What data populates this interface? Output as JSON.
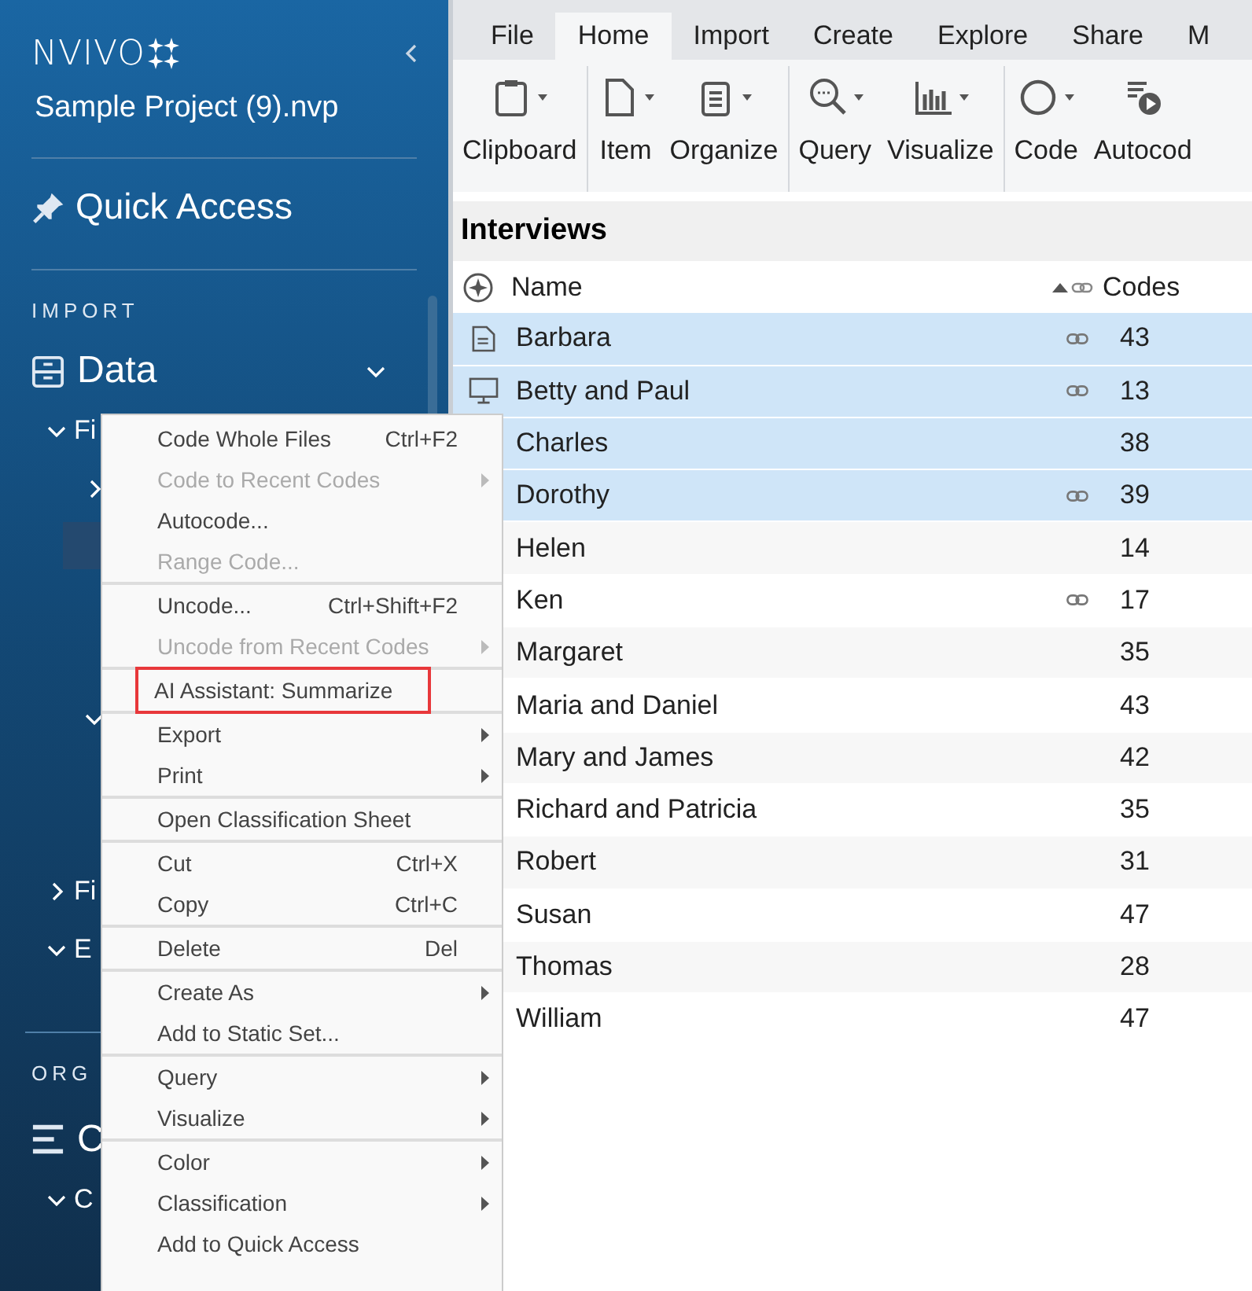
{
  "sidebar": {
    "logo": "NVIVO",
    "project": "Sample Project (9).nvp",
    "quick_access": "Quick Access",
    "section": "IMPORT",
    "data_heading": {
      "label": "Data",
      "expanded": true
    },
    "tree": [
      {
        "label": "Fi",
        "expanded": true,
        "children": [
          {
            "expanded": false
          },
          {
            "selected": true
          },
          {
            "expanded": true
          }
        ]
      },
      {
        "label": "Fi",
        "expanded": false
      },
      {
        "label": "E",
        "expanded": true
      }
    ],
    "section_2": "ORG",
    "heading_2": "C",
    "tree_2": [
      {
        "label": "C",
        "expanded": true
      }
    ]
  },
  "tabs": [
    {
      "label": "File",
      "selected": false
    },
    {
      "label": "Home",
      "selected": true
    },
    {
      "label": "Import",
      "selected": false
    },
    {
      "label": "Create",
      "selected": false
    },
    {
      "label": "Explore",
      "selected": false
    },
    {
      "label": "Share",
      "selected": false
    },
    {
      "label": "M",
      "selected": false
    }
  ],
  "ribbon": [
    [
      {
        "label": "Clipboard",
        "kind": "clipboard",
        "dropdown": true
      }
    ],
    [
      {
        "label": "Item",
        "kind": "file",
        "dropdown": true
      },
      {
        "label": "Organize",
        "kind": "list",
        "dropdown": true
      }
    ],
    [
      {
        "label": "Query",
        "kind": "search",
        "dropdown": true
      },
      {
        "label": "Visualize",
        "kind": "chart",
        "dropdown": true
      }
    ],
    [
      {
        "label": "Code",
        "kind": "circle",
        "dropdown": true
      },
      {
        "label": "Autocod",
        "kind": "autocode",
        "dropdown": false
      }
    ]
  ],
  "list": {
    "title": "Interviews",
    "columns": [
      "Name",
      "Codes"
    ],
    "rows": [
      {
        "name": "Barbara",
        "kind": "document",
        "linked": true,
        "codes": "43",
        "selected": true
      },
      {
        "name": "Betty and Paul",
        "kind": "video",
        "linked": true,
        "codes": "13",
        "selected": true
      },
      {
        "name": "Charles",
        "linked": false,
        "codes": "38",
        "selected": true
      },
      {
        "name": "Dorothy",
        "linked": true,
        "codes": "39",
        "selected": true
      },
      {
        "name": "Helen",
        "linked": false,
        "codes": "14",
        "selected": false
      },
      {
        "name": "Ken",
        "linked": true,
        "codes": "17",
        "selected": false
      },
      {
        "name": "Margaret",
        "linked": false,
        "codes": "35",
        "selected": false
      },
      {
        "name": "Maria and Daniel",
        "linked": false,
        "codes": "43",
        "selected": false
      },
      {
        "name": "Mary and James",
        "linked": false,
        "codes": "42",
        "selected": false
      },
      {
        "name": "Richard and Patricia",
        "linked": false,
        "codes": "35",
        "selected": false
      },
      {
        "name": "Robert",
        "linked": false,
        "codes": "31",
        "selected": false
      },
      {
        "name": "Susan",
        "linked": false,
        "codes": "47",
        "selected": false
      },
      {
        "name": "Thomas",
        "linked": false,
        "codes": "28",
        "selected": false
      },
      {
        "name": "William",
        "linked": false,
        "codes": "47",
        "selected": false
      }
    ]
  },
  "context_menu": [
    [
      {
        "label": "Code Whole Files",
        "shortcut": "Ctrl+F2",
        "disabled": false,
        "submenu": false
      },
      {
        "label": "Code to Recent Codes",
        "disabled": true,
        "submenu": true
      },
      {
        "label": "Autocode...",
        "disabled": false,
        "submenu": false
      },
      {
        "label": "Range Code...",
        "disabled": true,
        "submenu": false
      }
    ],
    [
      {
        "label": "Uncode...",
        "shortcut": "Ctrl+Shift+F2",
        "disabled": false,
        "submenu": false
      },
      {
        "label": "Uncode from Recent Codes",
        "disabled": true,
        "submenu": true
      }
    ],
    [
      {
        "label": "AI Assistant: Summarize",
        "disabled": false,
        "submenu": false,
        "highlighted": true
      }
    ],
    [
      {
        "label": "Export",
        "disabled": false,
        "submenu": true
      },
      {
        "label": "Print",
        "disabled": false,
        "submenu": true
      }
    ],
    [
      {
        "label": "Open Classification Sheet",
        "disabled": false,
        "submenu": false
      }
    ],
    [
      {
        "label": "Cut",
        "shortcut": "Ctrl+X",
        "disabled": false,
        "submenu": false
      },
      {
        "label": "Copy",
        "shortcut": "Ctrl+C",
        "disabled": false,
        "submenu": false
      }
    ],
    [
      {
        "label": "Delete",
        "shortcut": "Del",
        "disabled": false,
        "submenu": false
      }
    ],
    [
      {
        "label": "Create As",
        "disabled": false,
        "submenu": true
      },
      {
        "label": "Add to Static Set...",
        "disabled": false,
        "submenu": false
      }
    ],
    [
      {
        "label": "Query",
        "disabled": false,
        "submenu": true
      },
      {
        "label": "Visualize",
        "disabled": false,
        "submenu": true
      }
    ],
    [
      {
        "label": "Color",
        "disabled": false,
        "submenu": true
      },
      {
        "label": "Classification",
        "disabled": false,
        "submenu": true
      },
      {
        "label": "Add to Quick Access",
        "disabled": false,
        "submenu": false
      }
    ]
  ]
}
